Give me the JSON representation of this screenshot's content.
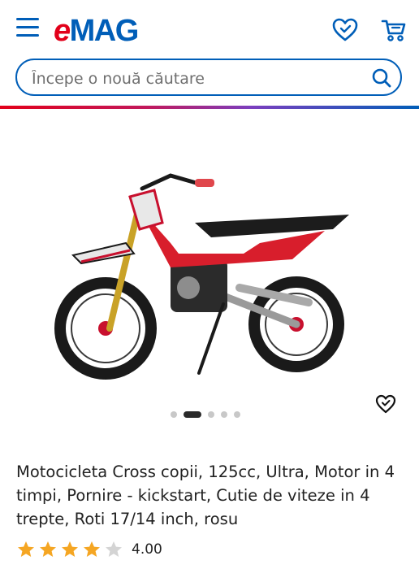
{
  "header": {
    "logo_e": "e",
    "logo_rest": "MAG",
    "icons": [
      "menu-icon",
      "heart-icon",
      "cart-icon"
    ]
  },
  "search": {
    "placeholder": "Începe o nouă căutare"
  },
  "gallery": {
    "image_count": 5,
    "active_index": 1
  },
  "product": {
    "title": "Motocicleta Cross copii, 125cc, Ultra, Motor in 4 timpi, Pornire - kickstart, Cutie de viteze in 4 trepte, Roti 17/14 inch, rosu",
    "rating_value": "4.00",
    "stars_filled": 4,
    "stars_total": 5
  },
  "colors": {
    "brand_blue": "#005eb8",
    "brand_red": "#e2001a",
    "star": "#f5a623"
  }
}
